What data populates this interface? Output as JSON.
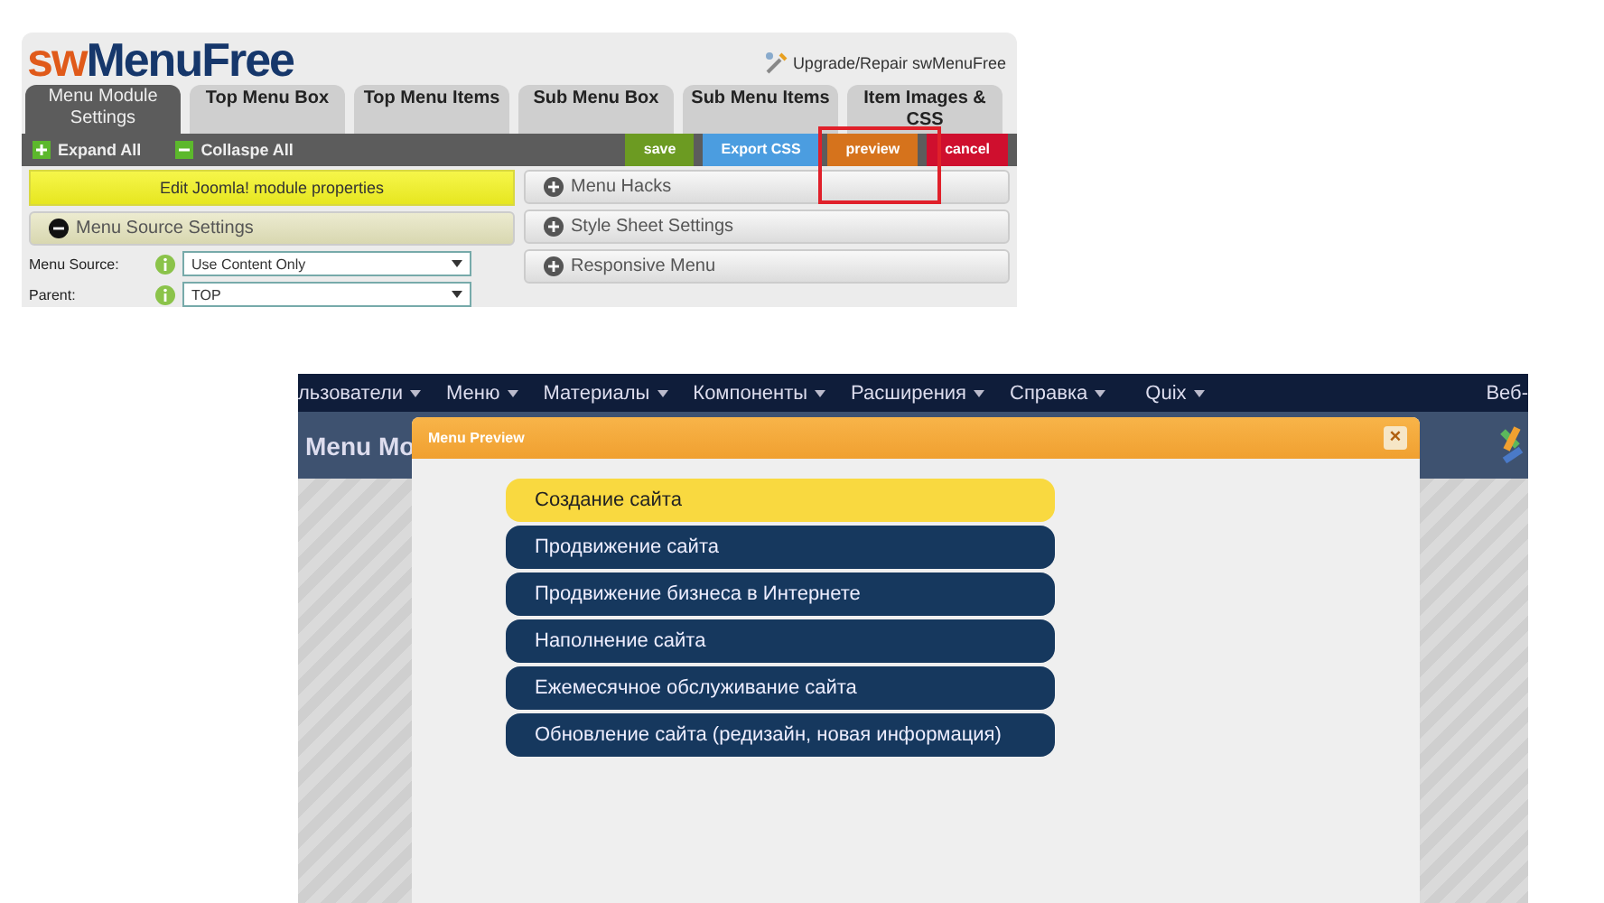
{
  "editor": {
    "logo": {
      "prefix": "sw",
      "name": "MenuFree"
    },
    "upgrade_link": "Upgrade/Repair swMenuFree",
    "tabs": [
      {
        "label": "Menu Module Settings",
        "selected": true
      },
      {
        "label": "Top Menu Box",
        "selected": false
      },
      {
        "label": "Top Menu Items",
        "selected": false
      },
      {
        "label": "Sub Menu Box",
        "selected": false
      },
      {
        "label": "Sub Menu Items",
        "selected": false
      },
      {
        "label": "Item Images & CSS",
        "selected": false
      }
    ],
    "toolbar": {
      "expand": "Expand All",
      "collapse": "Collaspe All",
      "buttons": [
        {
          "label": "save",
          "kind": "save"
        },
        {
          "label": "Export CSS",
          "kind": "export"
        },
        {
          "label": "preview",
          "kind": "preview"
        },
        {
          "label": "cancel",
          "kind": "cancel"
        }
      ]
    },
    "edit_link": "Edit Joomla! module properties",
    "left_sections": [
      {
        "title": "Menu Source Settings",
        "expanded": true
      }
    ],
    "fields": [
      {
        "label": "Menu Source:",
        "value": "Use Content Only"
      },
      {
        "label": "Parent:",
        "value": "TOP"
      }
    ],
    "right_sections": [
      {
        "title": "Menu Hacks",
        "expanded": false
      },
      {
        "title": "Style Sheet Settings",
        "expanded": false
      },
      {
        "title": "Responsive Menu",
        "expanded": false
      }
    ]
  },
  "admin": {
    "nav": [
      "льзователи",
      "Меню",
      "Материалы",
      "Компоненты",
      "Расширения",
      "Справка",
      "Quix"
    ],
    "nav_right": "Веб-",
    "header_title": "Menu Mo",
    "modal": {
      "title": "Menu Preview",
      "close_label": "×",
      "items": [
        {
          "label": "Создание сайта",
          "selected": true
        },
        {
          "label": "Продвижение сайта",
          "selected": false
        },
        {
          "label": "Продвижение бизнеса в Интернете",
          "selected": false
        },
        {
          "label": "Наполнение сайта",
          "selected": false
        },
        {
          "label": "Ежемесячное обслуживание сайта",
          "selected": false
        },
        {
          "label": "Обновление сайта (редизайн, новая информация)",
          "selected": false
        }
      ]
    }
  }
}
